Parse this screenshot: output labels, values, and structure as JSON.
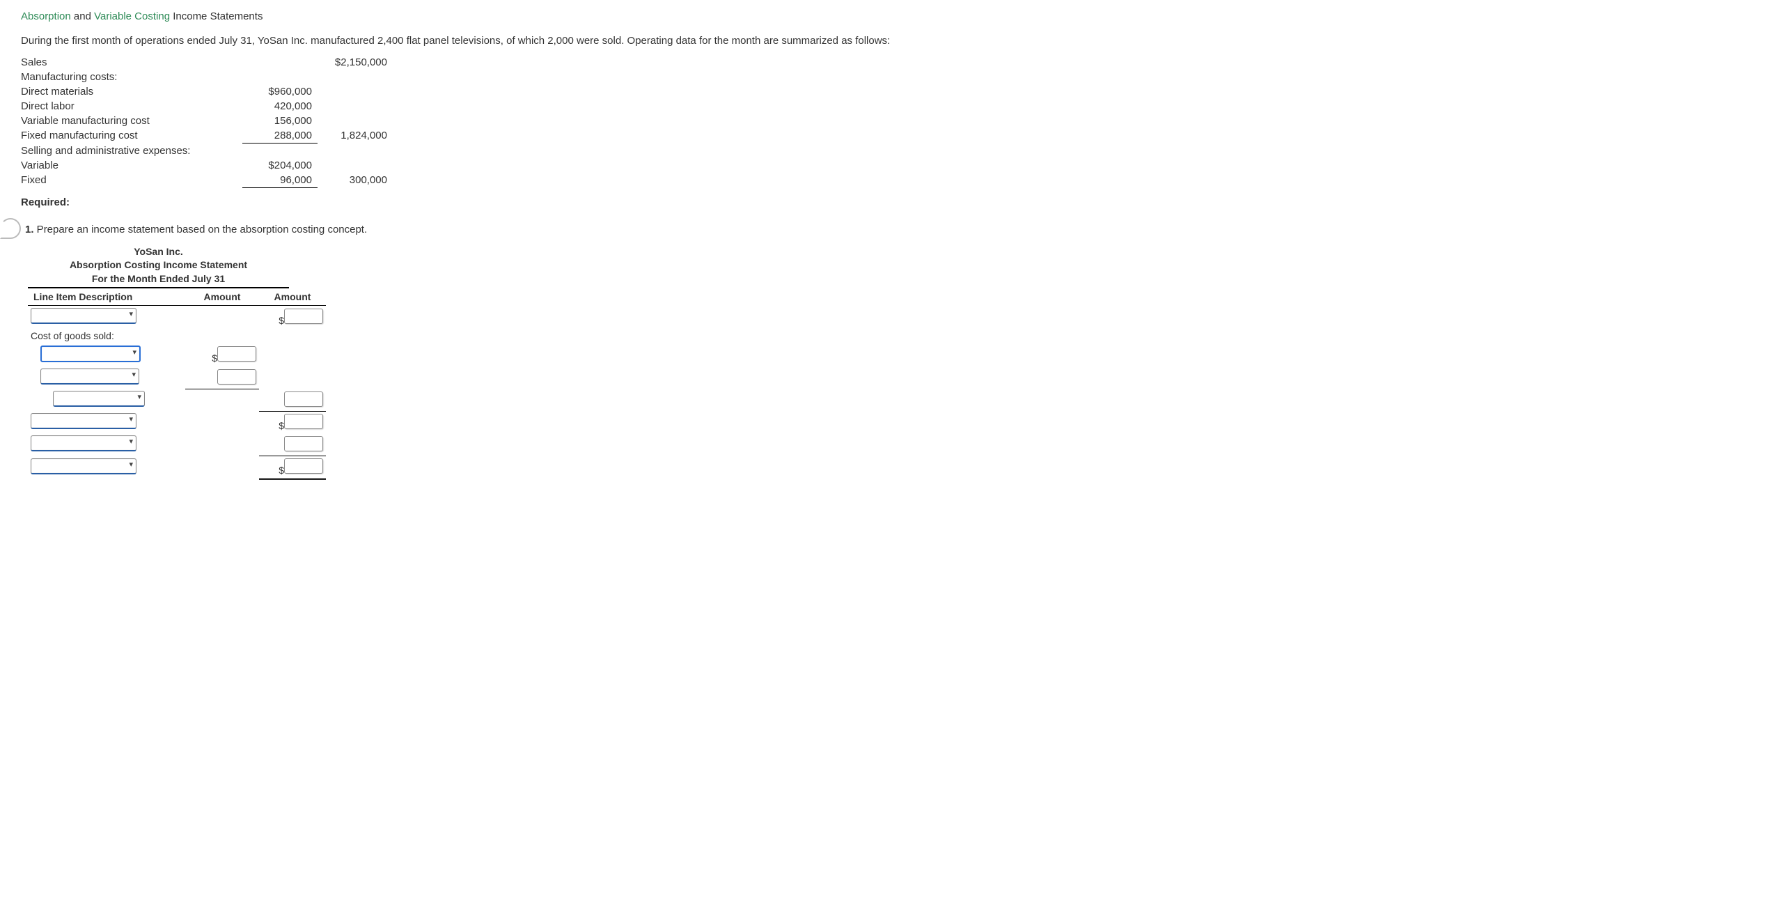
{
  "title": {
    "part1": "Absorption",
    "and": " and ",
    "part2": "Variable Costing",
    "rest": " Income Statements"
  },
  "intro": "During the first month of operations ended July 31, YoSan Inc. manufactured 2,400 flat panel televisions, of which 2,000 were sold. Operating data for the month are summarized as follows:",
  "data": {
    "sales_label": "Sales",
    "sales_amt": "$2,150,000",
    "mfg_label": "Manufacturing costs:",
    "dm_label": "Direct materials",
    "dm_amt": "$960,000",
    "dl_label": "Direct labor",
    "dl_amt": "420,000",
    "vmc_label": "Variable manufacturing cost",
    "vmc_amt": "156,000",
    "fmc_label": "Fixed manufacturing cost",
    "fmc_amt": "288,000",
    "mfg_total": "1,824,000",
    "sa_label": "Selling and administrative expenses:",
    "var_label": "Variable",
    "var_amt": "$204,000",
    "fix_label": "Fixed",
    "fix_amt": "96,000",
    "sa_total": "300,000"
  },
  "required": "Required:",
  "q1": {
    "num": "1.",
    "text": "  Prepare an income statement based on the absorption costing concept."
  },
  "statement": {
    "company": "YoSan Inc.",
    "title": "Absorption Costing Income Statement",
    "period": "For the Month Ended July 31",
    "h1": "Line Item Description",
    "h2": "Amount",
    "h3": "Amount",
    "cogs": "Cost of goods sold:"
  }
}
